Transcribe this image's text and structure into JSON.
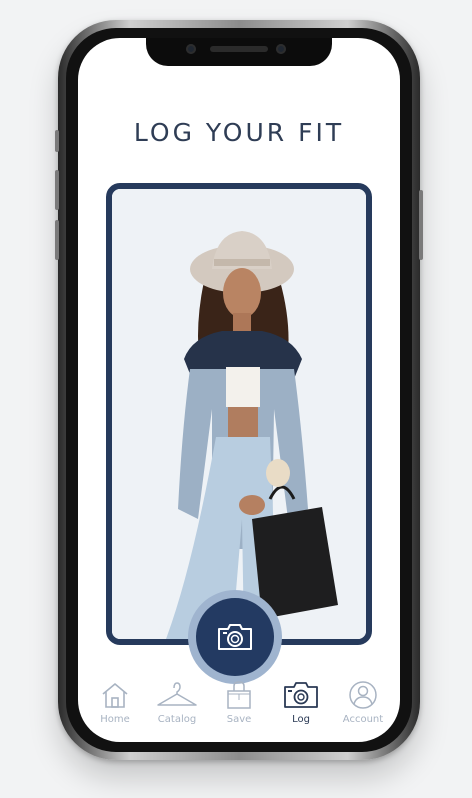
{
  "header": {
    "title": "LOG YOUR FIT"
  },
  "photo": {
    "subject": "photo-of-outfit"
  },
  "capture": {
    "icon": "camera-icon"
  },
  "nav": {
    "items": [
      {
        "label": "Home",
        "icon": "home-icon",
        "active": false
      },
      {
        "label": "Catalog",
        "icon": "hanger-icon",
        "active": false
      },
      {
        "label": "Save",
        "icon": "shopping-bag-icon",
        "active": false
      },
      {
        "label": "Log",
        "icon": "camera-icon",
        "active": true
      },
      {
        "label": "Account",
        "icon": "user-icon",
        "active": false
      }
    ]
  },
  "colors": {
    "accent": "#233a62",
    "ring": "#9fb4cf",
    "inactive": "#a8b3c2",
    "title": "#2f3d55"
  }
}
